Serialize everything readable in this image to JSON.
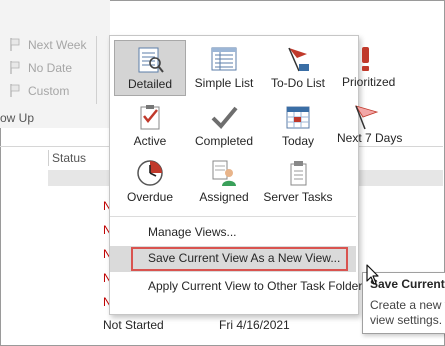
{
  "ribbon": {
    "followup_items": [
      {
        "label": "Next Week",
        "icon": "flag-icon"
      },
      {
        "label": "No Date",
        "icon": "flag-icon"
      },
      {
        "label": "Custom",
        "icon": "flag-icon"
      }
    ],
    "group_label": "ow Up"
  },
  "task_list": {
    "status_header": "Status",
    "red_marks": [
      "N",
      "N",
      "N",
      "N",
      "N"
    ],
    "bottom_row": {
      "status": "Not Started",
      "date": "Fri 4/16/2021"
    }
  },
  "views_dropdown": {
    "views": [
      {
        "label": "Detailed",
        "icon": "detailed-view-icon",
        "selected": true
      },
      {
        "label": "Simple List",
        "icon": "simple-list-icon"
      },
      {
        "label": "To-Do List",
        "icon": "to-do-list-icon"
      },
      {
        "label": "Prioritized",
        "icon": "prioritized-icon"
      },
      {
        "label": "Active",
        "icon": "active-icon"
      },
      {
        "label": "Completed",
        "icon": "completed-checkmark-icon"
      },
      {
        "label": "Today",
        "icon": "today-calendar-icon"
      },
      {
        "label": "Next 7 Days",
        "icon": "next-7-days-flag-icon"
      },
      {
        "label": "Overdue",
        "icon": "overdue-clock-icon"
      },
      {
        "label": "Assigned",
        "icon": "assigned-person-icon"
      },
      {
        "label": "Server Tasks",
        "icon": "server-tasks-icon"
      }
    ],
    "menu": {
      "manage_views": "Manage Views...",
      "save_as_new_view": "Save Current View As a New View...",
      "apply_view": "Apply Current View to Other Task Folder"
    }
  },
  "tooltip": {
    "title": "Save Current",
    "line1": "Create a new v",
    "line2": "view settings."
  },
  "colors": {
    "highlight_border": "#d9534f",
    "selected_tile": "#d4d4d4",
    "hover_row": "#dadada",
    "status_red": "#c00000"
  }
}
